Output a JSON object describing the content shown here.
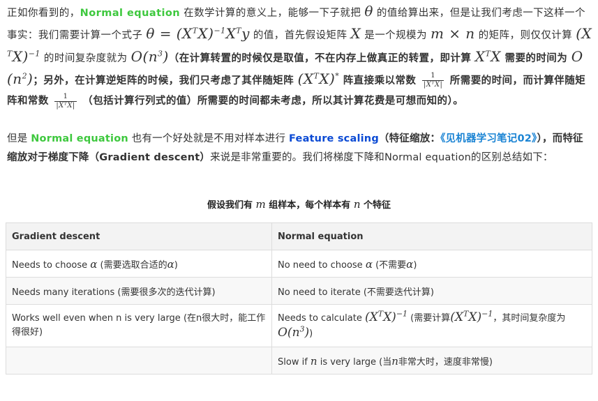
{
  "para1": {
    "p01": "正如你看到的，",
    "ne": "Normal equation",
    "p02": " 在数学计算的意义上，能够一下子就把 ",
    "theta": "θ",
    "p03": " 的值给算出来，但是让我们考虑一下这样一个事实：我们需要计算一个式子 ",
    "f_theta_lhs": "θ = (X",
    "sup_T": "T",
    "f_x": "X)",
    "sup_neg1": "−1",
    "f_xt": "X",
    "f_y": "y",
    "p04": " 的值，首先假设矩阵 ",
    "X": "X",
    "p05": " 是一个规模为 ",
    "mxn": "m × n",
    "p06": " 的矩阵，则仅仅计算 ",
    "f_inv1": "(X",
    "p07": " 的时间复杂度就为 ",
    "O": "O(n",
    "sup_3": "3",
    "close_paren": ")",
    "b01": "（在计算转置的时候仅是取值，不在内存上做真正的转置，即计算 ",
    "b02": " 需要的时间为 ",
    "sup_2": "2",
    "b03": "；另外，在计算逆矩阵的时候，我们只考虑了其伴随矩阵 ",
    "sup_star": "*",
    "b04": " 阵直接乘以常数 ",
    "frac_num": "1",
    "frac_den": "|XᵀX|",
    "b05": " 所需要的时间，而计算伴随矩阵和常数 ",
    "b06": " （包括计算行列式的值）所需要的时间都未考虑，所以其计算花费是可想而知的）。"
  },
  "para2": {
    "p01": "但是 ",
    "ne": "Normal equation",
    "p02": " 也有一个好处就是不用对样本进行 ",
    "fs": "Feature scaling",
    "p03": "（特征缩放：",
    "link": "《见机器学习笔记02》",
    "p04": "），而特征缩放对于",
    "gd_cn": "梯度下降（Gradient descent）",
    "p05": "来说是非常重要的。我们将梯度下降和Normal equation的区别总结如下："
  },
  "caption": {
    "p1": "假设我们有 ",
    "m": "m",
    "p2": " 组样本，每个样本有 ",
    "n": "n",
    "p3": " 个特征"
  },
  "table": {
    "headers": [
      "Gradient descent",
      "Normal equation"
    ],
    "r1": {
      "left_a": "Needs to choose ",
      "alpha": "α",
      "left_b": " (需要选取合适的",
      "left_c": ")",
      "right_a": "No need to choose ",
      "right_b": " (不需要",
      "right_c": ")"
    },
    "r2": {
      "left": "Needs many iterations (需要很多次的迭代计算)",
      "right": "No need to iterate (不需要迭代计算)"
    },
    "r3": {
      "left": "Works well even when n is very large (在n很大时，能工作得很好)",
      "right_a": "Needs to calculate ",
      "right_b": " (需要计算",
      "right_c": "，其时间复杂度为",
      "right_d": ")"
    },
    "r4": {
      "left": "",
      "right_a": "Slow if ",
      "n": "n",
      "right_b": " is very large (当",
      "right_c": "非常大时，速度非常慢)"
    }
  },
  "colors": {
    "green": "#3ec83e",
    "blue": "#0b4ad4",
    "link": "#1b84d4",
    "header_bg": "#f3f3f3",
    "border": "#dcdcdc"
  }
}
